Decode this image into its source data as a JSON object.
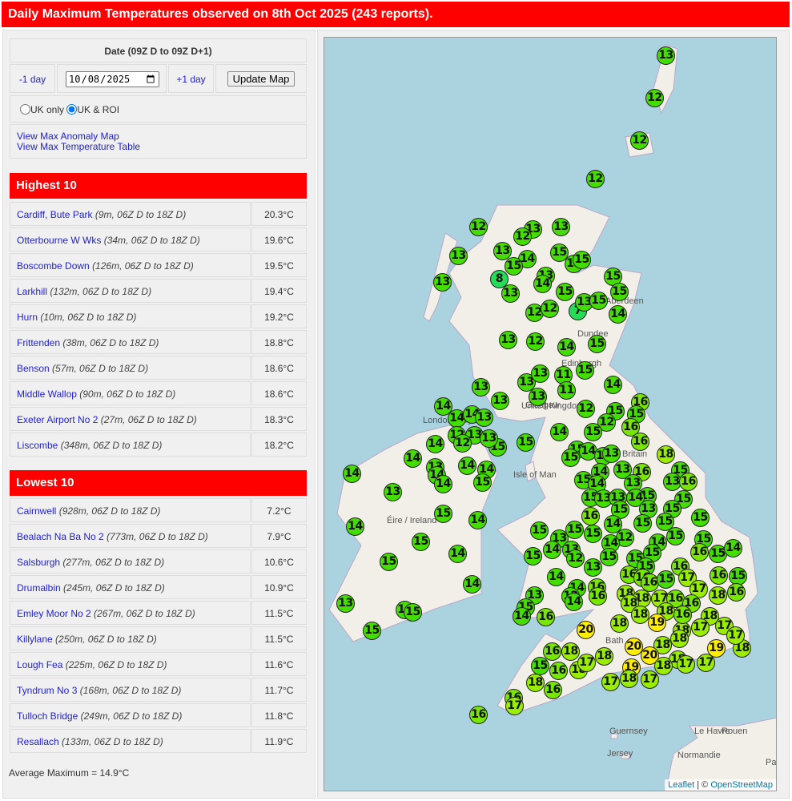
{
  "header": {
    "title": "Daily Maximum Temperatures observed on 8th Oct 2025 (243 reports)."
  },
  "controls": {
    "date_heading": "Date (09Z D to 09Z D+1)",
    "prev_day": "-1 day",
    "date_value": "2025-10-08",
    "next_day": "+1 day",
    "update_button": "Update Map",
    "radio_uk_only": "UK only",
    "radio_uk_roi": "UK & ROI",
    "selected_region": "UK & ROI",
    "link_anomaly": "View Max Anomaly Map",
    "link_table": "View Max Temperature Table"
  },
  "highest": {
    "title": "Highest 10",
    "rows": [
      {
        "name": "Cardiff, Bute Park",
        "info": "(9m, 06Z D to 18Z D)",
        "value": "20.3°C"
      },
      {
        "name": "Otterbourne W Wks",
        "info": "(34m, 06Z D to 18Z D)",
        "value": "19.6°C"
      },
      {
        "name": "Boscombe Down",
        "info": "(126m, 06Z D to 18Z D)",
        "value": "19.5°C"
      },
      {
        "name": "Larkhill",
        "info": "(132m, 06Z D to 18Z D)",
        "value": "19.4°C"
      },
      {
        "name": "Hurn",
        "info": "(10m, 06Z D to 18Z D)",
        "value": "19.2°C"
      },
      {
        "name": "Frittenden",
        "info": "(38m, 06Z D to 18Z D)",
        "value": "18.8°C"
      },
      {
        "name": "Benson",
        "info": "(57m, 06Z D to 18Z D)",
        "value": "18.6°C"
      },
      {
        "name": "Middle Wallop",
        "info": "(90m, 06Z D to 18Z D)",
        "value": "18.6°C"
      },
      {
        "name": "Exeter Airport No 2",
        "info": "(27m, 06Z D to 18Z D)",
        "value": "18.3°C"
      },
      {
        "name": "Liscombe",
        "info": "(348m, 06Z D to 18Z D)",
        "value": "18.2°C"
      }
    ]
  },
  "lowest": {
    "title": "Lowest 10",
    "rows": [
      {
        "name": "Cairnwell",
        "info": "(928m, 06Z D to 18Z D)",
        "value": "7.2°C"
      },
      {
        "name": "Bealach Na Ba No 2",
        "info": "(773m, 06Z D to 18Z D)",
        "value": "7.9°C"
      },
      {
        "name": "Salsburgh",
        "info": "(277m, 06Z D to 18Z D)",
        "value": "10.6°C"
      },
      {
        "name": "Drumalbin",
        "info": "(245m, 06Z D to 18Z D)",
        "value": "10.9°C"
      },
      {
        "name": "Emley Moor No 2",
        "info": "(267m, 06Z D to 18Z D)",
        "value": "11.5°C"
      },
      {
        "name": "Killylane",
        "info": "(250m, 06Z D to 18Z D)",
        "value": "11.5°C"
      },
      {
        "name": "Lough Fea",
        "info": "(225m, 06Z D to 18Z D)",
        "value": "11.6°C"
      },
      {
        "name": "Tyndrum No 3",
        "info": "(168m, 06Z D to 18Z D)",
        "value": "11.7°C"
      },
      {
        "name": "Tulloch Bridge",
        "info": "(249m, 06Z D to 18Z D)",
        "value": "11.8°C"
      },
      {
        "name": "Resallach",
        "info": "(133m, 06Z D to 18Z D)",
        "value": "11.9°C"
      }
    ]
  },
  "average": "Average Maximum = 14.9°C",
  "map": {
    "labels": [
      "Aberdeen",
      "Dundee",
      "Edinburgh",
      "Glasgow",
      "United Kingdom",
      "Londonderry",
      "Isle of Man",
      "Éire / Ireland",
      "Britain",
      "Bath",
      "Guernsey",
      "Jersey",
      "Le Havre",
      "Rouen",
      "Normandie",
      "Pa"
    ],
    "attribution": {
      "leaflet": "Leaflet",
      "sep": " | © ",
      "osm": "OpenStreetMap"
    },
    "colors": {
      "cold": "#22dd55",
      "mild": "#44dd00",
      "warm16": "#77e600",
      "warm": "#99ee00",
      "hot": "#ffee00",
      "sea": "#aad3df",
      "land": "#f2efe9"
    },
    "marker_values": [
      13,
      12,
      12,
      12,
      12,
      13,
      13,
      12,
      13,
      13,
      15,
      15,
      15,
      14,
      15,
      13,
      8,
      13,
      14,
      15,
      15,
      15,
      13,
      12,
      12,
      7,
      13,
      15,
      14,
      13,
      12,
      14,
      15,
      13,
      13,
      13,
      13,
      11,
      15,
      11,
      13,
      14,
      14,
      14,
      14,
      13,
      12,
      13,
      12,
      15,
      13,
      12,
      15,
      12,
      16,
      15,
      16,
      15,
      14,
      15,
      16,
      14,
      14,
      13,
      14,
      14,
      14,
      14,
      15,
      14,
      13,
      15,
      14,
      13,
      13,
      15,
      18,
      14,
      13,
      16,
      15,
      13,
      16,
      15,
      14,
      13,
      15,
      15,
      15,
      13,
      13,
      14,
      13,
      15,
      15,
      16,
      14,
      15,
      15,
      15,
      15,
      14,
      14,
      15,
      14,
      15,
      15,
      13,
      15,
      15,
      12,
      14,
      15,
      15,
      14,
      15,
      14,
      13,
      15,
      15,
      15,
      16,
      15,
      14,
      12,
      13,
      15,
      16,
      17,
      16,
      15,
      14,
      14,
      16,
      16,
      16,
      16,
      15,
      17,
      18,
      16,
      14,
      13,
      14,
      15,
      13,
      12,
      16,
      18,
      18,
      17,
      16,
      18,
      15,
      14,
      16,
      14,
      18,
      16,
      18,
      18,
      19,
      18,
      17,
      17,
      15,
      20,
      18,
      16,
      18,
      18,
      19,
      18,
      17,
      20,
      20,
      18,
      17,
      17,
      18,
      16,
      18,
      18,
      15,
      16,
      18,
      19,
      17,
      18,
      17,
      18,
      17,
      16,
      16,
      17,
      16
    ]
  }
}
